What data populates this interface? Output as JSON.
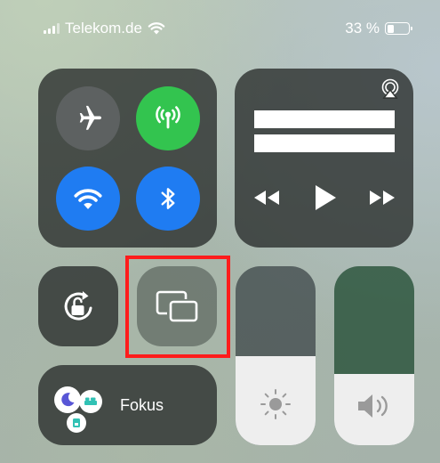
{
  "status_bar": {
    "carrier": "Telekom.de",
    "battery_text": "33 %",
    "battery_level": 0.33,
    "icons": [
      "signal-icon",
      "wifi-icon",
      "battery-icon"
    ]
  },
  "connectivity": {
    "airplane_mode": {
      "icon": "airplane-icon",
      "on": false,
      "color": "#5f6464"
    },
    "cellular_data": {
      "icon": "antenna-icon",
      "on": true,
      "color": "#33c44f"
    },
    "wifi": {
      "icon": "wifi-icon",
      "on": true,
      "color": "#1f7cf2"
    },
    "bluetooth": {
      "icon": "bluetooth-icon",
      "on": true,
      "color": "#1f7cf2"
    }
  },
  "media": {
    "icons": [
      "airplay-audio-icon",
      "rewind-icon",
      "play-icon",
      "fast-forward-icon"
    ]
  },
  "controls": {
    "orientation_lock": {
      "icon": "rotation-lock-icon"
    },
    "screen_mirroring": {
      "icon": "screen-mirroring-icon",
      "highlighted": true,
      "highlight_color": "#ff1c1c"
    }
  },
  "focus": {
    "label": "Fokus",
    "icons": [
      "moon-icon",
      "bed-icon",
      "badge-icon"
    ]
  },
  "sliders": {
    "brightness": {
      "icon": "sun-icon",
      "level": 0.5
    },
    "volume": {
      "icon": "speaker-icon",
      "level": 0.4
    }
  }
}
